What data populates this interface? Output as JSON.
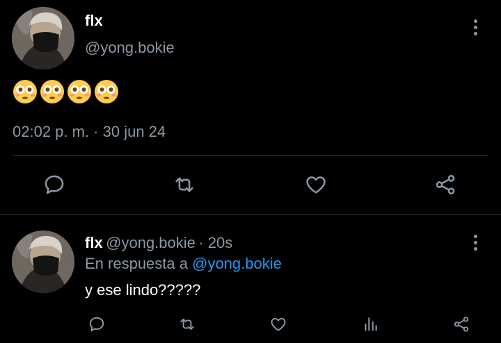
{
  "tweet": {
    "author_name": "flx",
    "author_handle": "@yong.bokie",
    "content_emoji": "😳😳😳😳",
    "emoji_count": 4,
    "timestamp": "02:02 p. m. · 30 jun 24",
    "actions": [
      "reply-icon",
      "retweet-icon",
      "like-icon",
      "share-icon"
    ]
  },
  "reply": {
    "author_name": "flx",
    "author_handle": "@yong.bokie",
    "time_ago": "· 20s",
    "in_reply_to_prefix": "En respuesta a",
    "in_reply_to_handle": "@yong.bokie",
    "text": "y ese lindo?????",
    "actions": [
      "reply-icon",
      "retweet-icon",
      "like-icon",
      "views-icon",
      "share-icon"
    ]
  },
  "colors": {
    "background": "#000000",
    "text_primary": "#ffffff",
    "text_secondary": "#8b98a5",
    "link": "#1d9bf0",
    "divider": "#2f3336",
    "emoji_face": "#ffcc4d"
  }
}
